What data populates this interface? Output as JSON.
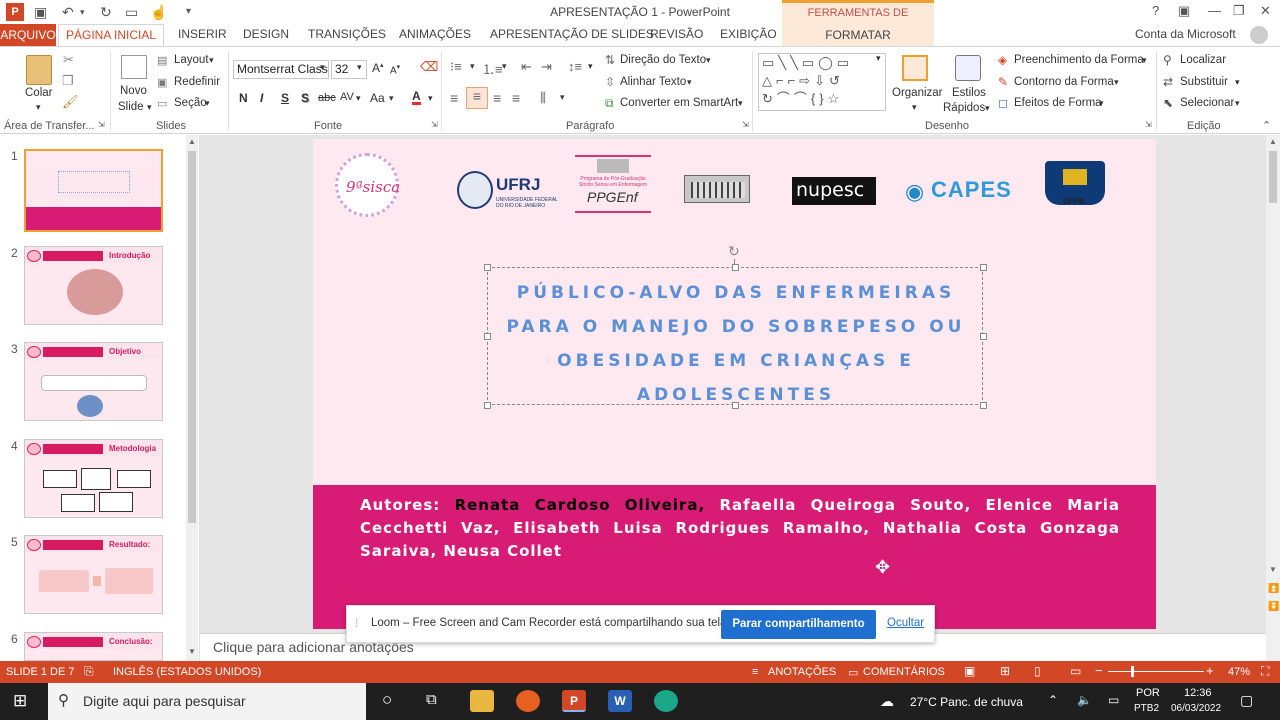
{
  "window": {
    "title": "APRESENTAÇÃO 1 - PowerPoint",
    "contextual_group": "FERRAMENTAS DE DESENHO",
    "help": "?",
    "account": "Conta da Microsoft"
  },
  "tabs": {
    "arquivo": "ARQUIVO",
    "home": "PÁGINA INICIAL",
    "inserir": "INSERIR",
    "design": "DESIGN",
    "transicoes": "TRANSIÇÕES",
    "animacoes": "ANIMAÇÕES",
    "apresentacao": "APRESENTAÇÃO DE SLIDES",
    "revisao": "REVISÃO",
    "exibicao": "EXIBIÇÃO",
    "formatar": "FORMATAR"
  },
  "ribbon": {
    "clipboard": {
      "paste": "Colar",
      "label": "Área de Transfer..."
    },
    "slides": {
      "new_slide_1": "Novo",
      "new_slide_2": "Slide",
      "layout": "Layout",
      "reset": "Redefinir",
      "section": "Seção",
      "label": "Slides"
    },
    "font": {
      "name": "Montserrat Class",
      "size": "32",
      "bold": "N",
      "italic": "I",
      "underline": "S",
      "shadow": "S",
      "strike": "abc",
      "spacing": "AV",
      "case": "Aa",
      "color": "A",
      "label": "Fonte"
    },
    "paragraph": {
      "text_direction": "Direção do Texto",
      "align_text": "Alinhar Texto",
      "smartart": "Converter em SmartArt",
      "label": "Parágrafo"
    },
    "drawing": {
      "arrange": "Organizar",
      "quick_styles_1": "Estilos",
      "quick_styles_2": "Rápidos",
      "fill": "Preenchimento da Forma",
      "outline": "Contorno da Forma",
      "effects": "Efeitos de Forma",
      "label": "Desenho"
    },
    "editing": {
      "find": "Localizar",
      "replace": "Substituir",
      "select": "Selecionar",
      "label": "Edição"
    }
  },
  "thumbnails": [
    {
      "num": "1",
      "heading": ""
    },
    {
      "num": "2",
      "heading": "Introdução"
    },
    {
      "num": "3",
      "heading": "Objetivo"
    },
    {
      "num": "4",
      "heading": "Metodologia"
    },
    {
      "num": "5",
      "heading": "Resultado:"
    },
    {
      "num": "6",
      "heading": "Conclusão:"
    }
  ],
  "slide": {
    "logos": {
      "sisca": "9ªsisca",
      "ufrj": "UFRJ",
      "ufrj_sub": "UNIVERSIDADE FEDERAL DO RIO DE JANEIRO",
      "ppgenf": "PPGEnf",
      "ppgenf_sub": "Programa de Pós-Graduação Stricto Sensu em Enfermagem",
      "nupesc": "nupesc",
      "capes": "CAPES",
      "ufpb": "UFPB"
    },
    "title_line1": "PÚBLICO-ALVO DAS ENFERMEIRAS",
    "title_line2": "PARA O MANEJO DO SOBREPESO OU",
    "title_line3": "OBESIDADE EM CRIANÇAS E",
    "title_line4": "ADOLESCENTES",
    "authors_prefix": "Autores: ",
    "authors_highlight": "Renata Cardoso Oliveira,",
    "authors_rest": " Rafaella Queiroga Souto, Elenice Maria Cecchetti Vaz, Elisabeth Luisa Rodrigues Ramalho, Nathalia Costa Gonzaga Saraiva, Neusa Collet"
  },
  "notes": "Clique para adicionar anotações",
  "loom": {
    "message": "Loom – Free Screen and Cam Recorder está compartilhando sua tela.",
    "stop": "Parar compartilhamento",
    "hide": "Ocultar"
  },
  "status": {
    "slide": "SLIDE 1 DE 7",
    "language": "INGLÊS (ESTADOS UNIDOS)",
    "notes": "ANOTAÇÕES",
    "comments": "COMENTÁRIOS",
    "zoom": "47%"
  },
  "taskbar": {
    "search": "Digite aqui para pesquisar",
    "weather": "27°C  Panc. de chuva",
    "lang1": "POR",
    "lang2": "PTB2",
    "time": "12:36",
    "date": "06/03/2022"
  },
  "colors": {
    "accent": "#d24726",
    "slide_pink": "#d81b75",
    "title_blue": "#5b8fd6",
    "loom_blue": "#1f6fd0"
  }
}
